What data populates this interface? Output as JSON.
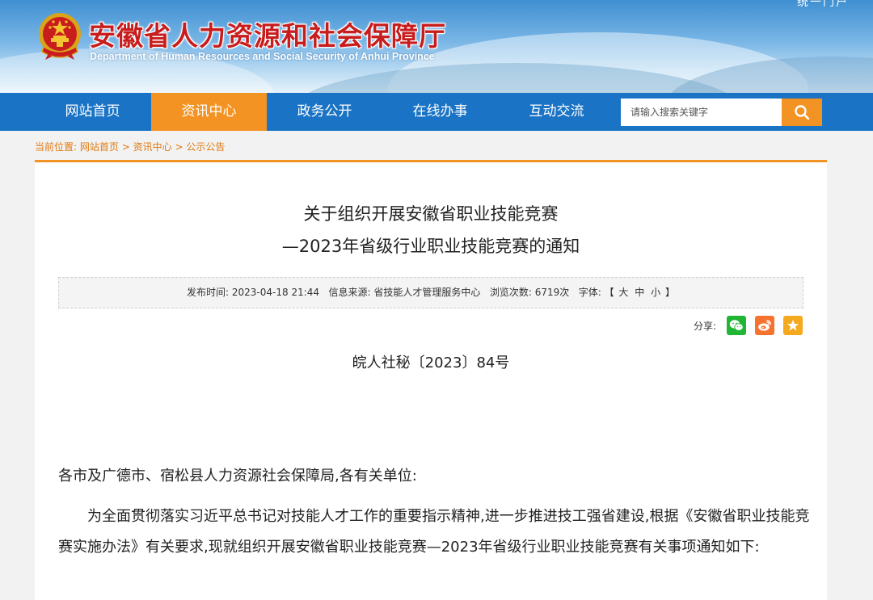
{
  "header": {
    "title": "安徽省人力资源和社会保障厅",
    "subtitle_en": "Department of Human Resources and Social Security of Anhui Province",
    "corner_text": "统一门户"
  },
  "nav": {
    "items": [
      {
        "label": "网站首页"
      },
      {
        "label": "资讯中心",
        "active": true
      },
      {
        "label": "政务公开"
      },
      {
        "label": "在线办事"
      },
      {
        "label": "互动交流"
      }
    ],
    "search_placeholder": "请输入搜索关键字",
    "search_icon": "search-icon"
  },
  "breadcrumb": {
    "prefix": "当前位置:",
    "items": [
      "网站首页",
      "资讯中心",
      "公示公告"
    ],
    "separator": ">"
  },
  "article": {
    "title_line1": "关于组织开展安徽省职业技能竞赛",
    "title_line2": "—2023年省级行业职业技能竞赛的通知",
    "meta": {
      "publish_label": "发布时间:",
      "publish_time": "2023-04-18 21:44",
      "source_label": "信息来源:",
      "source": "省技能人才管理服务中心",
      "views_label": "浏览次数:",
      "views": "6719次",
      "font_label": "字体:",
      "font_open": "【",
      "font_large": "大",
      "font_medium": "中",
      "font_small": "小",
      "font_close": "】"
    },
    "share_label": "分享:",
    "share_icons": [
      "wechat-icon",
      "weibo-icon",
      "favorite-icon"
    ],
    "doc_number": "皖人社秘〔2023〕84号",
    "addressee": "各市及广德市、宿松县人力资源社会保障局,各有关单位:",
    "body": "为全面贯彻落实习近平总书记对技能人才工作的重要指示精神,进一步推进技工强省建设,根据《安徽省职业技能竞赛实施办法》有关要求,现就组织开展安徽省职业技能竞赛—2023年省级行业职业技能竞赛有关事项通知如下:"
  },
  "colors": {
    "nav_bg": "#1a73c4",
    "accent_orange": "#f39323",
    "title_red": "#c81d1d",
    "wechat_green": "#20b535",
    "weibo_orange": "#f5722f",
    "star_orange": "#f4a91f"
  }
}
